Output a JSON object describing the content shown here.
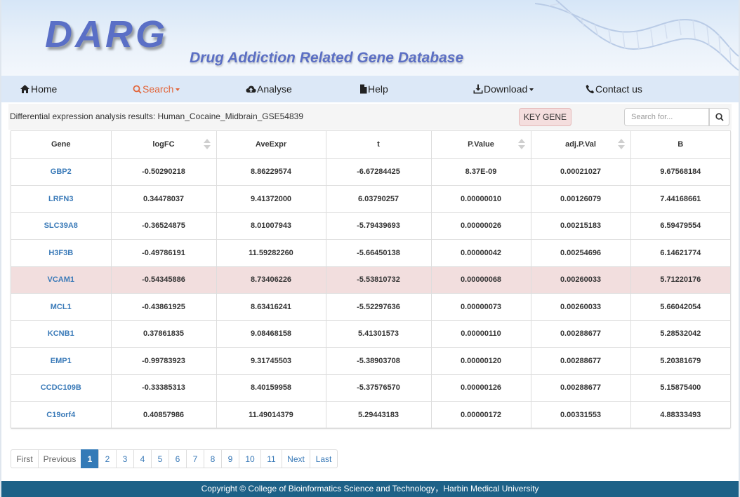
{
  "header": {
    "logo": "DARG",
    "subtitle": "Drug Addiction Related Gene Database"
  },
  "nav": {
    "items": [
      {
        "label": "Home",
        "icon": "home-icon",
        "active": false
      },
      {
        "label": "Search",
        "icon": "search-icon",
        "active": true,
        "dropdown": true
      },
      {
        "label": "Analyse",
        "icon": "cloud-upload-icon",
        "active": false
      },
      {
        "label": "Help",
        "icon": "file-icon",
        "active": false
      },
      {
        "label": "Download",
        "icon": "download-icon",
        "active": false,
        "dropdown": true
      },
      {
        "label": "Contact us",
        "icon": "phone-icon",
        "active": false
      }
    ]
  },
  "toolbar": {
    "result_title": "Differential expression analysis results: Human_Cocaine_Midbrain_GSE54839",
    "key_gene_label": "KEY GENE",
    "search_placeholder": "Search for..."
  },
  "table": {
    "columns": [
      "Gene",
      "logFC",
      "AveExpr",
      "t",
      "P.Value",
      "adj.P.Val",
      "B"
    ],
    "rows": [
      [
        "GBP2",
        "-0.50290218",
        "8.86229574",
        "-6.67284425",
        "8.37E-09",
        "0.00021027",
        "9.67568184"
      ],
      [
        "LRFN3",
        "0.34478037",
        "9.41372000",
        "6.03790257",
        "0.00000010",
        "0.00126079",
        "7.44168661"
      ],
      [
        "SLC39A8",
        "-0.36524875",
        "8.01007943",
        "-5.79439693",
        "0.00000026",
        "0.00215183",
        "6.59479554"
      ],
      [
        "H3F3B",
        "-0.49786191",
        "11.59282260",
        "-5.66450138",
        "0.00000042",
        "0.00254696",
        "6.14621774"
      ],
      [
        "VCAM1",
        "-0.54345886",
        "8.73406226",
        "-5.53810732",
        "0.00000068",
        "0.00260033",
        "5.71220176"
      ],
      [
        "MCL1",
        "-0.43861925",
        "8.63416241",
        "-5.52297636",
        "0.00000073",
        "0.00260033",
        "5.66042054"
      ],
      [
        "KCNB1",
        "0.37861835",
        "9.08468158",
        "5.41301573",
        "0.00000110",
        "0.00288677",
        "5.28532042"
      ],
      [
        "EMP1",
        "-0.99783923",
        "9.31745503",
        "-5.38903708",
        "0.00000120",
        "0.00288677",
        "5.20381679"
      ],
      [
        "CCDC109B",
        "-0.33385313",
        "8.40159958",
        "-5.37576570",
        "0.00000126",
        "0.00288677",
        "5.15875400"
      ],
      [
        "C19orf4",
        "0.40857986",
        "11.49014379",
        "5.29443183",
        "0.00000172",
        "0.00331553",
        "4.88333493"
      ]
    ],
    "highlight_row": 4
  },
  "pagination": {
    "first": "First",
    "previous": "Previous",
    "pages": [
      "1",
      "2",
      "3",
      "4",
      "5",
      "6",
      "7",
      "8",
      "9",
      "10",
      "11"
    ],
    "current": "1",
    "next": "Next",
    "last": "Last"
  },
  "footer": {
    "copyright": "Copyright © College of Bioinformatics Science and Technology，Harbin Medical University"
  },
  "colors": {
    "accent": "#337ab7",
    "nav_active": "#e2653a",
    "highlight_row": "#f2dede",
    "footer_bg": "#1d6187",
    "logo": "#5a6fc6"
  }
}
